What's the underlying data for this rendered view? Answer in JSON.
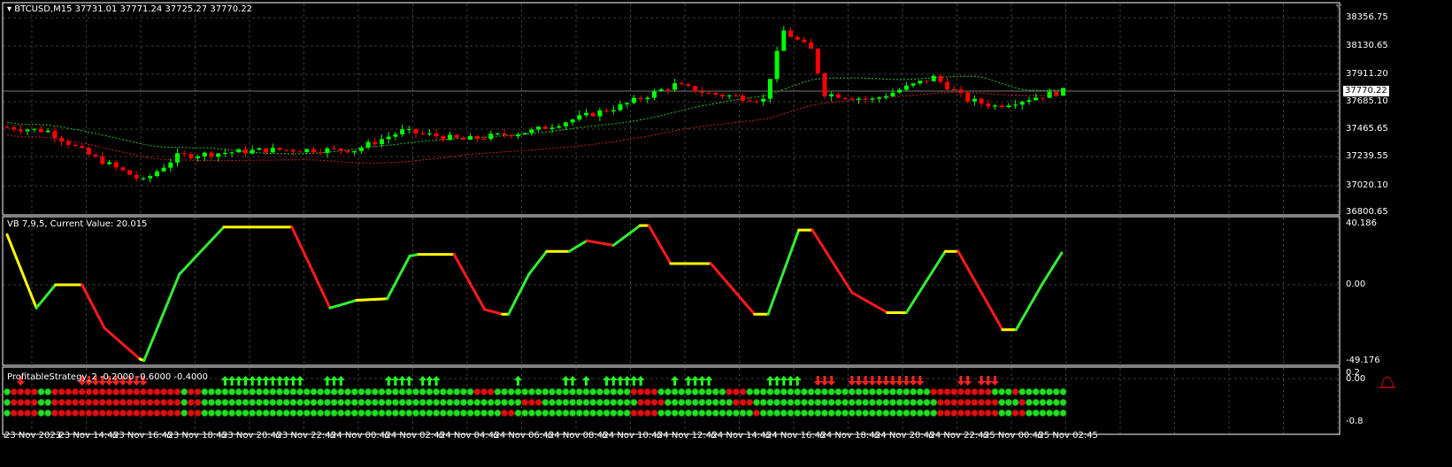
{
  "main": {
    "symbol_header": "BTCUSD,M15  37731.01 37771.24 37725.27 37770.22",
    "current_price": "37770.22",
    "price_axis": [
      "38356.75",
      "38130.65",
      "37911.20",
      "37685.10",
      "37465.65",
      "37239.55",
      "37020.10",
      "36800.65"
    ],
    "price_range": [
      36800.65,
      38356.75
    ],
    "colors": {
      "bull": "#00ff00",
      "bear": "#ff0000",
      "ma_fast": "#22cc22",
      "ma_slow": "#cc2222",
      "grid": "#3a3a3a"
    },
    "close_keypoints": [
      [
        0,
        37480
      ],
      [
        6,
        37450
      ],
      [
        12,
        37260
      ],
      [
        20,
        37050
      ],
      [
        25,
        37250
      ],
      [
        38,
        37300
      ],
      [
        51,
        37300
      ],
      [
        58,
        37450
      ],
      [
        67,
        37380
      ],
      [
        77,
        37450
      ],
      [
        90,
        37650
      ],
      [
        98,
        37820
      ],
      [
        103,
        37750
      ],
      [
        111,
        37700
      ],
      [
        114,
        38250
      ],
      [
        118,
        38100
      ],
      [
        120,
        37750
      ],
      [
        127,
        37700
      ],
      [
        136,
        37880
      ],
      [
        141,
        37700
      ],
      [
        145,
        37650
      ],
      [
        155,
        37770
      ]
    ]
  },
  "vb": {
    "label": "VB 7,9,5, Current Value: 20.015",
    "axis": [
      "40.186",
      "0.00",
      "-49.176"
    ],
    "range": [
      -49.176,
      40.186
    ],
    "colors": {
      "up": "#33ee33",
      "down": "#ff1a1a",
      "flat": "#ffff00"
    },
    "points": [
      [
        0,
        33,
        "R"
      ],
      [
        4.3,
        -15,
        "Y"
      ],
      [
        7.1,
        0,
        "G"
      ],
      [
        11,
        0,
        "Y"
      ],
      [
        14.3,
        -28,
        "R"
      ],
      [
        19.5,
        -48,
        "R"
      ],
      [
        20.1,
        -49,
        "Y"
      ],
      [
        25.3,
        7,
        "G"
      ],
      [
        31.8,
        38,
        "G"
      ],
      [
        41.8,
        38,
        "Y"
      ],
      [
        47.4,
        -15,
        "R"
      ],
      [
        51.3,
        -10,
        "G"
      ],
      [
        55.8,
        -9,
        "Y"
      ],
      [
        59.1,
        19,
        "G"
      ],
      [
        60.4,
        20,
        "G"
      ],
      [
        65.6,
        20,
        "Y"
      ],
      [
        70.1,
        -16,
        "R"
      ],
      [
        72.7,
        -19,
        "R"
      ],
      [
        73.6,
        -19,
        "Y"
      ],
      [
        76.6,
        7,
        "G"
      ],
      [
        79.2,
        22,
        "G"
      ],
      [
        82.5,
        22,
        "Y"
      ],
      [
        85.1,
        29,
        "G"
      ],
      [
        89,
        26,
        "R"
      ],
      [
        92.9,
        39,
        "G"
      ],
      [
        94.2,
        39,
        "Y"
      ],
      [
        97.4,
        14,
        "R"
      ],
      [
        103.3,
        14,
        "Y"
      ],
      [
        109.7,
        -19,
        "R"
      ],
      [
        111.7,
        -19,
        "Y"
      ],
      [
        116.2,
        36,
        "G"
      ],
      [
        118.2,
        36,
        "Y"
      ],
      [
        124,
        -5,
        "R"
      ],
      [
        129.2,
        -18,
        "R"
      ],
      [
        132,
        -18,
        "Y"
      ],
      [
        137.7,
        22,
        "G"
      ],
      [
        139.6,
        22,
        "Y"
      ],
      [
        146.1,
        -29,
        "R"
      ],
      [
        148.1,
        -29,
        "Y"
      ],
      [
        152,
        1,
        "G"
      ],
      [
        154.8,
        21,
        "G"
      ]
    ]
  },
  "strategy": {
    "label": "ProfitableStrategy_2 -0.2000 -0.6000 -0.4000",
    "axis": [
      "0.2",
      "0.00",
      "-0.8"
    ],
    "rows": [
      "G1R4G2R19G1R2G40R3G20R4G10R3G27R9G3R1G12R2G1R6G4R2G2",
      "G1R4G2R19G1R2G47R3G14R4G10R3G27R9G3R1G7R4G2R10G4R2G2",
      "G1R4G2R19G1R2G44R2G17R4G14R1G26R9G2R2G6R6G3R2G3R5G4R2G2"
    ],
    "up_arrows": [
      32,
      33,
      34,
      35,
      36,
      37,
      38,
      39,
      40,
      41,
      42,
      43,
      47,
      48,
      49,
      56,
      57,
      58,
      59,
      61,
      62,
      63,
      75,
      82,
      83,
      85,
      88,
      89,
      90,
      91,
      92,
      93,
      98,
      100,
      101,
      102,
      103,
      112,
      113,
      114,
      115,
      116
    ],
    "down_arrows": [
      2,
      11,
      12,
      13,
      14,
      15,
      16,
      17,
      18,
      19,
      20,
      119,
      120,
      121,
      124,
      125,
      126,
      127,
      128,
      129,
      130,
      131,
      132,
      133,
      134,
      140,
      141,
      143,
      144,
      145
    ]
  },
  "time_axis": [
    "23 Nov 2023",
    "23 Nov 14:45",
    "23 Nov 16:45",
    "23 Nov 18:45",
    "23 Nov 20:45",
    "23 Nov 22:45",
    "24 Nov 00:45",
    "24 Nov 02:45",
    "24 Nov 04:45",
    "24 Nov 06:45",
    "24 Nov 08:45",
    "24 Nov 10:45",
    "24 Nov 12:45",
    "24 Nov 14:45",
    "24 Nov 16:45",
    "24 Nov 18:45",
    "24 Nov 20:45",
    "24 Nov 22:45",
    "25 Nov 00:45",
    "25 Nov 02:45"
  ]
}
